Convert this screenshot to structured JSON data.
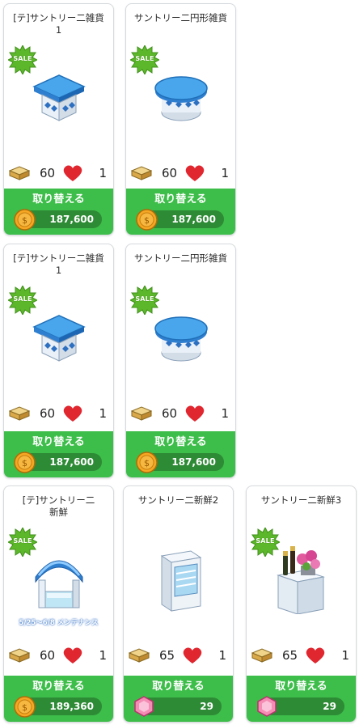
{
  "colors": {
    "exchange_green": "#3dbd49",
    "price_bar": "#2d8a35",
    "sale_green": "#5cb82a",
    "heart": "#e0262f"
  },
  "exchange_label": "取り替える",
  "cards": [
    {
      "title": "[テ]サントリー二雑貨\n1",
      "sale": "SALE",
      "item_icon": "square-table-icon",
      "boxes": "60",
      "hearts": "1",
      "price": "187,600",
      "currency": "coin"
    },
    {
      "title": "サントリー二円形雑貨",
      "sale": "SALE",
      "item_icon": "round-table-icon",
      "boxes": "60",
      "hearts": "1",
      "price": "187,600",
      "currency": "coin"
    },
    {
      "title": "[テ]サントリー二雑貨\n1",
      "sale": "SALE",
      "item_icon": "square-table-icon",
      "boxes": "60",
      "hearts": "1",
      "price": "187,600",
      "currency": "coin"
    },
    {
      "title": "サントリー二円形雑貨",
      "sale": "SALE",
      "item_icon": "round-table-icon",
      "boxes": "60",
      "hearts": "1",
      "price": "187,600",
      "currency": "coin"
    },
    {
      "title": "[テ]サントリー二\n新鮮",
      "sale": "SALE",
      "item_icon": "arch-kiosk-icon",
      "maintenance": "5/25～6/8 メンテナンス",
      "boxes": "60",
      "hearts": "1",
      "price": "189,360",
      "currency": "coin"
    },
    {
      "title": "サントリー二新鮮2",
      "item_icon": "display-fridge-icon",
      "boxes": "65",
      "hearts": "1",
      "price": "29",
      "currency": "gem"
    },
    {
      "title": "サントリー二新鮮3",
      "sale": "SALE",
      "item_icon": "wine-flower-stand-icon",
      "boxes": "65",
      "hearts": "1",
      "price": "29",
      "currency": "gem"
    }
  ]
}
